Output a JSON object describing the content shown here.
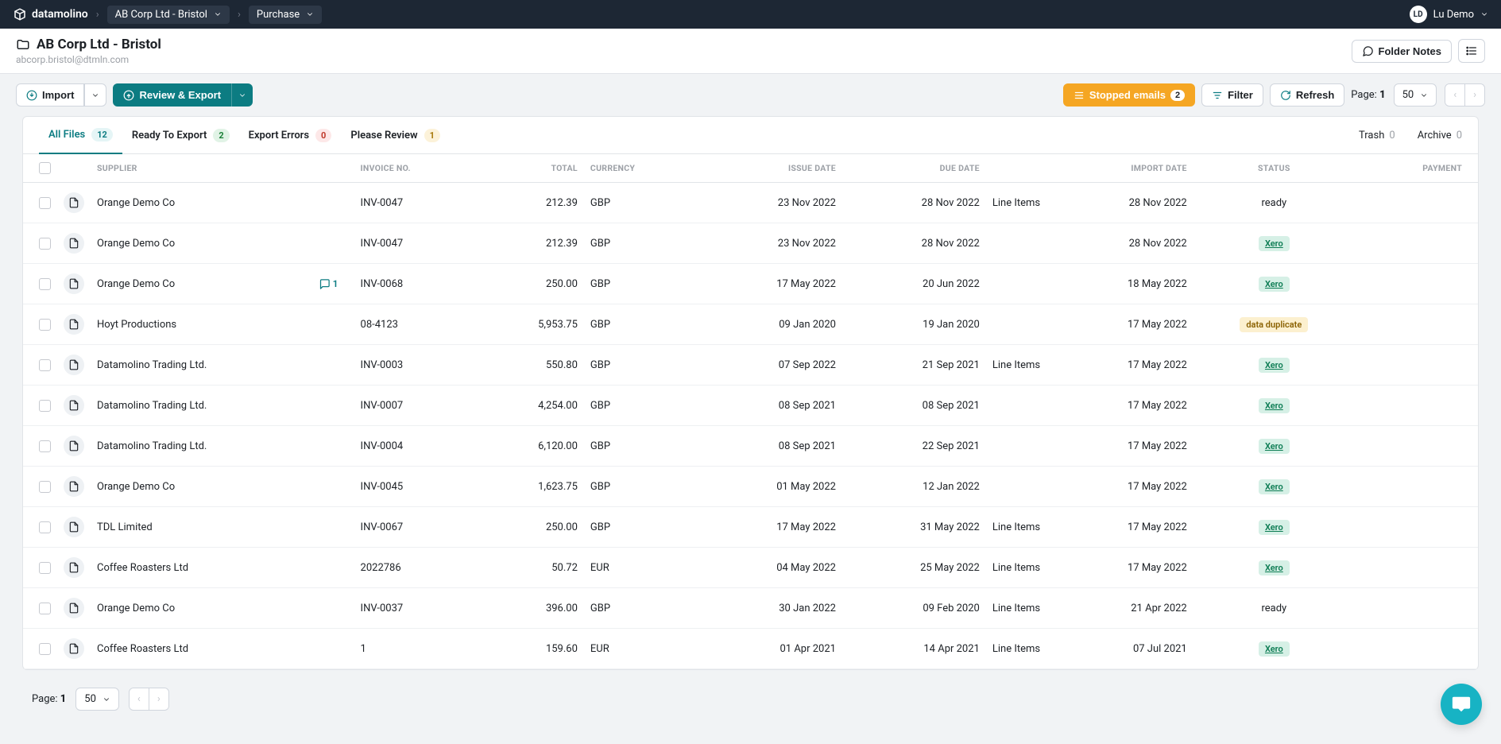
{
  "brand": "datamolino",
  "breadcrumb": {
    "folder": "AB Corp Ltd - Bristol",
    "section": "Purchase"
  },
  "user": {
    "initials": "LD",
    "name": "Lu Demo"
  },
  "header": {
    "title": "AB Corp Ltd - Bristol",
    "subtitle": "abcorp.bristol@dtmln.com",
    "folder_notes": "Folder Notes"
  },
  "toolbar": {
    "import": "Import",
    "review_export": "Review & Export",
    "stopped_emails": "Stopped emails",
    "stopped_count": "2",
    "filter": "Filter",
    "refresh": "Refresh",
    "page_label": "Page:",
    "page_num": "1",
    "page_size": "50"
  },
  "tabs": {
    "all_files": {
      "label": "All Files",
      "count": "12"
    },
    "ready": {
      "label": "Ready To Export",
      "count": "2"
    },
    "errors": {
      "label": "Export Errors",
      "count": "0"
    },
    "review": {
      "label": "Please Review",
      "count": "1"
    },
    "trash": {
      "label": "Trash",
      "count": "0"
    },
    "archive": {
      "label": "Archive",
      "count": "0"
    }
  },
  "columns": {
    "supplier": "SUPPLIER",
    "invoice": "INVOICE NO.",
    "total": "TOTAL",
    "currency": "CURRENCY",
    "issue": "ISSUE DATE",
    "due": "DUE DATE",
    "import": "IMPORT DATE",
    "status": "STATUS",
    "payment": "PAYMENT"
  },
  "status_labels": {
    "xero": "Xero",
    "duplicate": "data duplicate",
    "ready": "ready",
    "line_items": "Line Items"
  },
  "rows": [
    {
      "supplier": "Orange Demo Co",
      "invoice": "INV-0047",
      "total": "212.39",
      "currency": "GBP",
      "issue": "23 Nov 2022",
      "due": "28 Nov 2022",
      "line_items": true,
      "import": "28 Nov 2022",
      "status": "ready",
      "comments": ""
    },
    {
      "supplier": "Orange Demo Co",
      "invoice": "INV-0047",
      "total": "212.39",
      "currency": "GBP",
      "issue": "23 Nov 2022",
      "due": "28 Nov 2022",
      "line_items": false,
      "import": "28 Nov 2022",
      "status": "xero",
      "comments": ""
    },
    {
      "supplier": "Orange Demo Co",
      "invoice": "INV-0068",
      "total": "250.00",
      "currency": "GBP",
      "issue": "17 May 2022",
      "due": "20 Jun 2022",
      "line_items": false,
      "import": "18 May 2022",
      "status": "xero",
      "comments": "1"
    },
    {
      "supplier": "Hoyt Productions",
      "invoice": "08-4123",
      "total": "5,953.75",
      "currency": "GBP",
      "issue": "09 Jan 2020",
      "due": "19 Jan 2020",
      "line_items": false,
      "import": "17 May 2022",
      "status": "duplicate",
      "comments": ""
    },
    {
      "supplier": "Datamolino Trading Ltd.",
      "invoice": "INV-0003",
      "total": "550.80",
      "currency": "GBP",
      "issue": "07 Sep 2022",
      "due": "21 Sep 2021",
      "line_items": true,
      "import": "17 May 2022",
      "status": "xero",
      "comments": ""
    },
    {
      "supplier": "Datamolino Trading Ltd.",
      "invoice": "INV-0007",
      "total": "4,254.00",
      "currency": "GBP",
      "issue": "08 Sep 2021",
      "due": "08 Sep 2021",
      "line_items": false,
      "import": "17 May 2022",
      "status": "xero",
      "comments": ""
    },
    {
      "supplier": "Datamolino Trading Ltd.",
      "invoice": "INV-0004",
      "total": "6,120.00",
      "currency": "GBP",
      "issue": "08 Sep 2021",
      "due": "22 Sep 2021",
      "line_items": false,
      "import": "17 May 2022",
      "status": "xero",
      "comments": ""
    },
    {
      "supplier": "Orange Demo Co",
      "invoice": "INV-0045",
      "total": "1,623.75",
      "currency": "GBP",
      "issue": "01 May 2022",
      "due": "12 Jan 2022",
      "line_items": false,
      "import": "17 May 2022",
      "status": "xero",
      "comments": ""
    },
    {
      "supplier": "TDL Limited",
      "invoice": "INV-0067",
      "total": "250.00",
      "currency": "GBP",
      "issue": "17 May 2022",
      "due": "31 May 2022",
      "line_items": true,
      "import": "17 May 2022",
      "status": "xero",
      "comments": ""
    },
    {
      "supplier": "Coffee Roasters Ltd",
      "invoice": "2022786",
      "total": "50.72",
      "currency": "EUR",
      "issue": "04 May 2022",
      "due": "25 May 2022",
      "line_items": true,
      "import": "17 May 2022",
      "status": "xero",
      "comments": ""
    },
    {
      "supplier": "Orange Demo Co",
      "invoice": "INV-0037",
      "total": "396.00",
      "currency": "GBP",
      "issue": "30 Jan 2022",
      "due": "09 Feb 2020",
      "line_items": true,
      "import": "21 Apr 2022",
      "status": "ready",
      "comments": ""
    },
    {
      "supplier": "Coffee Roasters Ltd",
      "invoice": "1",
      "total": "159.60",
      "currency": "EUR",
      "issue": "01 Apr 2021",
      "due": "14 Apr 2021",
      "line_items": true,
      "import": "07 Jul 2021",
      "status": "xero",
      "comments": ""
    }
  ],
  "footer": {
    "page_label": "Page:",
    "page_num": "1",
    "page_size": "50"
  }
}
